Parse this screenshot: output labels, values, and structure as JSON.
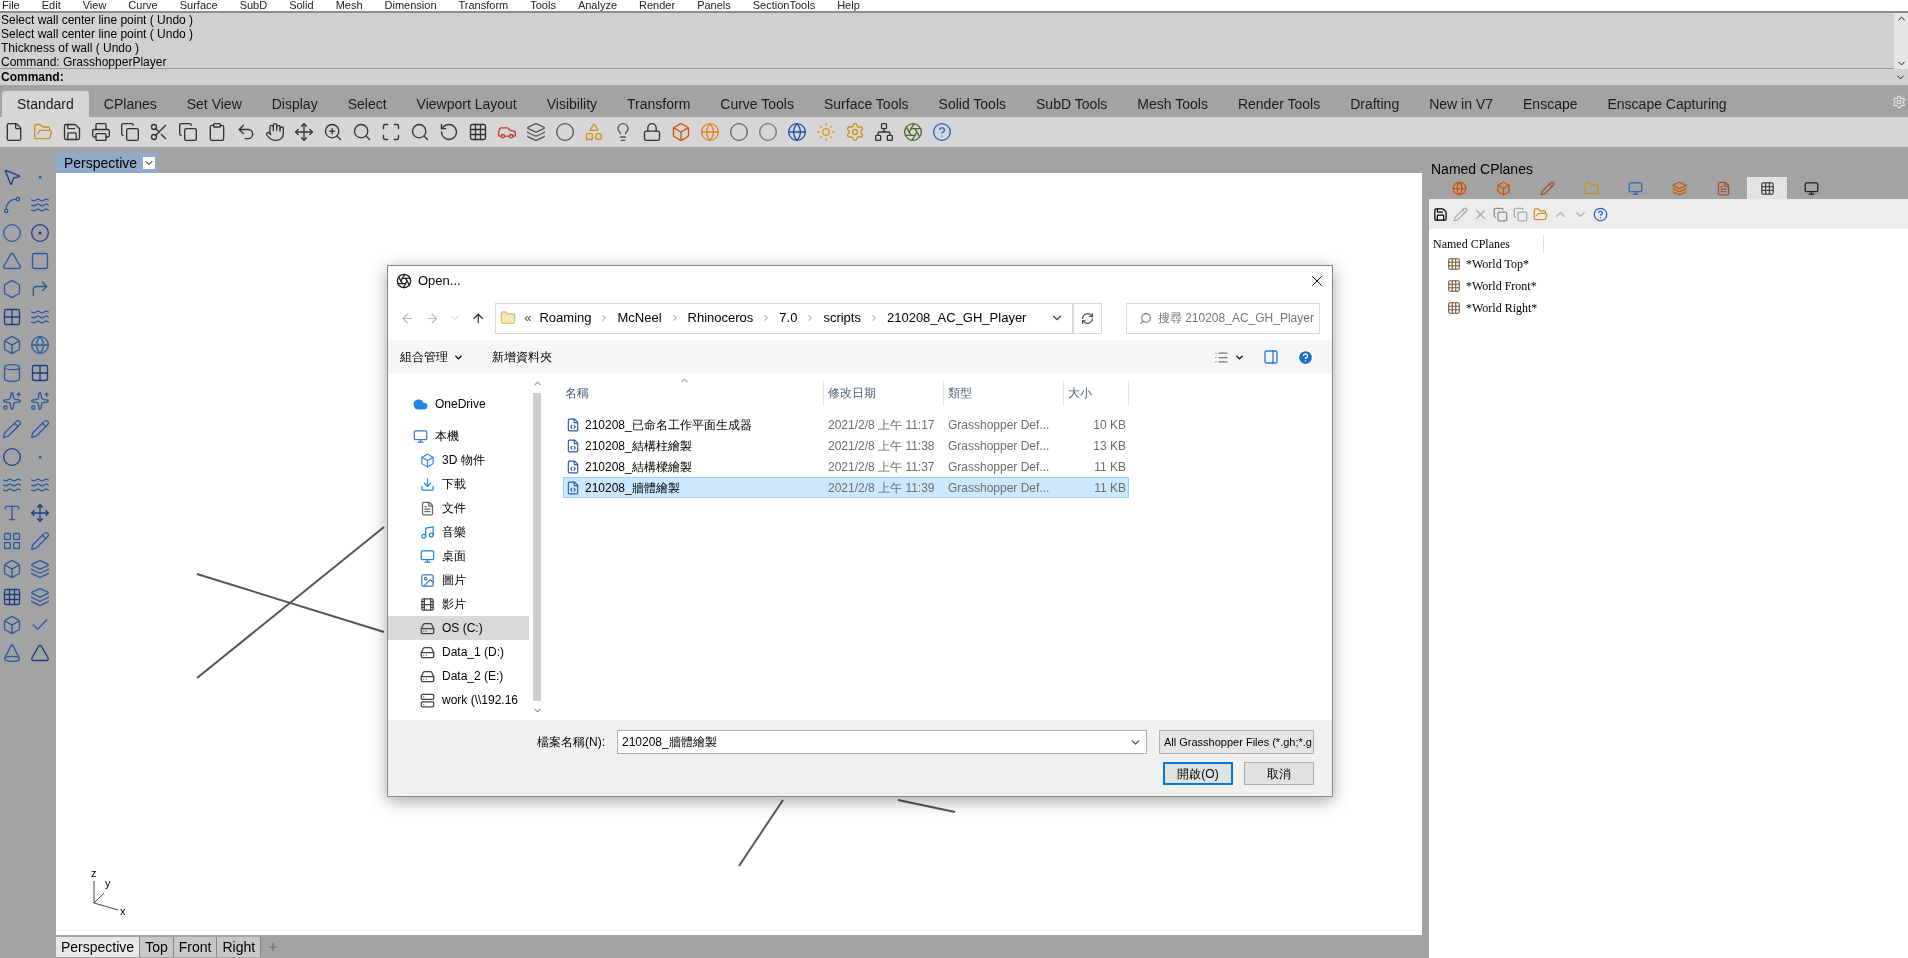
{
  "menu": [
    "File",
    "Edit",
    "View",
    "Curve",
    "Surface",
    "SubD",
    "Solid",
    "Mesh",
    "Dimension",
    "Transform",
    "Tools",
    "Analyze",
    "Render",
    "Panels",
    "SectionTools",
    "Help"
  ],
  "command_history": [
    "Select wall center line point ( Undo )",
    "Select wall center line point ( Undo )",
    "Thickness of wall ( Undo )",
    "Command: GrasshopperPlayer"
  ],
  "command_prompt": "Command:",
  "toolbar_tabs": [
    {
      "label": "Standard",
      "selected": true
    },
    {
      "label": "CPlanes",
      "selected": false
    },
    {
      "label": "Set View",
      "selected": false
    },
    {
      "label": "Display",
      "selected": false
    },
    {
      "label": "Select",
      "selected": false
    },
    {
      "label": "Viewport Layout",
      "selected": false
    },
    {
      "label": "Visibility",
      "selected": false
    },
    {
      "label": "Transform",
      "selected": false
    },
    {
      "label": "Curve Tools",
      "selected": false
    },
    {
      "label": "Surface Tools",
      "selected": false
    },
    {
      "label": "Solid Tools",
      "selected": false
    },
    {
      "label": "SubD Tools",
      "selected": false
    },
    {
      "label": "Mesh Tools",
      "selected": false
    },
    {
      "label": "Render Tools",
      "selected": false
    },
    {
      "label": "Drafting",
      "selected": false
    },
    {
      "label": "New in V7",
      "selected": false
    },
    {
      "label": "Enscape",
      "selected": false
    },
    {
      "label": "Enscape Capturing",
      "selected": false
    }
  ],
  "viewport": {
    "title": "Perspective",
    "axis_z": "z",
    "axis_y": "y",
    "axis_x": "x"
  },
  "viewport_tabs": [
    {
      "label": "Perspective",
      "selected": true
    },
    {
      "label": "Top",
      "selected": false
    },
    {
      "label": "Front",
      "selected": false
    },
    {
      "label": "Right",
      "selected": false
    }
  ],
  "panel": {
    "title": "Named CPlanes",
    "tabs": [
      {
        "selected": false
      },
      {
        "selected": false
      },
      {
        "selected": false
      },
      {
        "selected": false
      },
      {
        "selected": false
      },
      {
        "selected": false
      },
      {
        "selected": false
      },
      {
        "selected": true
      },
      {
        "selected": false
      }
    ],
    "list_header": "Named CPlanes",
    "items": [
      "*World Top*",
      "*World Front*",
      "*World Right*"
    ]
  },
  "dialog": {
    "title": "Open...",
    "path_overflow": "«",
    "path": [
      "Roaming",
      "McNeel",
      "Rhinoceros",
      "7.0",
      "scripts",
      "210208_AC_GH_Player"
    ],
    "search_placeholder": "搜尋 210208_AC_GH_Player",
    "organize": "組合管理",
    "new_folder": "新增資料夾",
    "nav": [
      {
        "label": "OneDrive",
        "selected": false
      },
      {
        "label": "本機",
        "selected": false,
        "children": [
          {
            "label": "3D 物件",
            "selected": false
          },
          {
            "label": "下載",
            "selected": false
          },
          {
            "label": "文件",
            "selected": false
          },
          {
            "label": "音樂",
            "selected": false
          },
          {
            "label": "桌面",
            "selected": false
          },
          {
            "label": "圖片",
            "selected": false
          },
          {
            "label": "影片",
            "selected": false
          },
          {
            "label": "OS (C:)",
            "selected": true
          },
          {
            "label": "Data_1 (D:)",
            "selected": false
          },
          {
            "label": "Data_2 (E:)",
            "selected": false
          },
          {
            "label": "work (\\\\192.16",
            "selected": false
          }
        ]
      }
    ],
    "columns": [
      "名稱",
      "修改日期",
      "類型",
      "大小"
    ],
    "files": [
      {
        "name": "210208_已命名工作平面生成器",
        "date": "2021/2/8 上午 11:17",
        "type": "Grasshopper Def...",
        "size": "10 KB",
        "selected": false
      },
      {
        "name": "210208_結構柱繪製",
        "date": "2021/2/8 上午 11:38",
        "type": "Grasshopper Def...",
        "size": "13 KB",
        "selected": false
      },
      {
        "name": "210208_結構樑繪製",
        "date": "2021/2/8 上午 11:37",
        "type": "Grasshopper Def...",
        "size": "11 KB",
        "selected": false
      },
      {
        "name": "210208_牆體繪製",
        "date": "2021/2/8 上午 11:39",
        "type": "Grasshopper Def...",
        "size": "11 KB",
        "selected": true
      }
    ],
    "filename_label": "檔案名稱(N):",
    "filename": "210208_牆體繪製",
    "filter": "All Grasshopper Files (*.gh;*.g",
    "buttons": [
      {
        "label": "開啟(O)",
        "kind": "default"
      },
      {
        "label": "取消",
        "kind": "normal"
      }
    ]
  }
}
